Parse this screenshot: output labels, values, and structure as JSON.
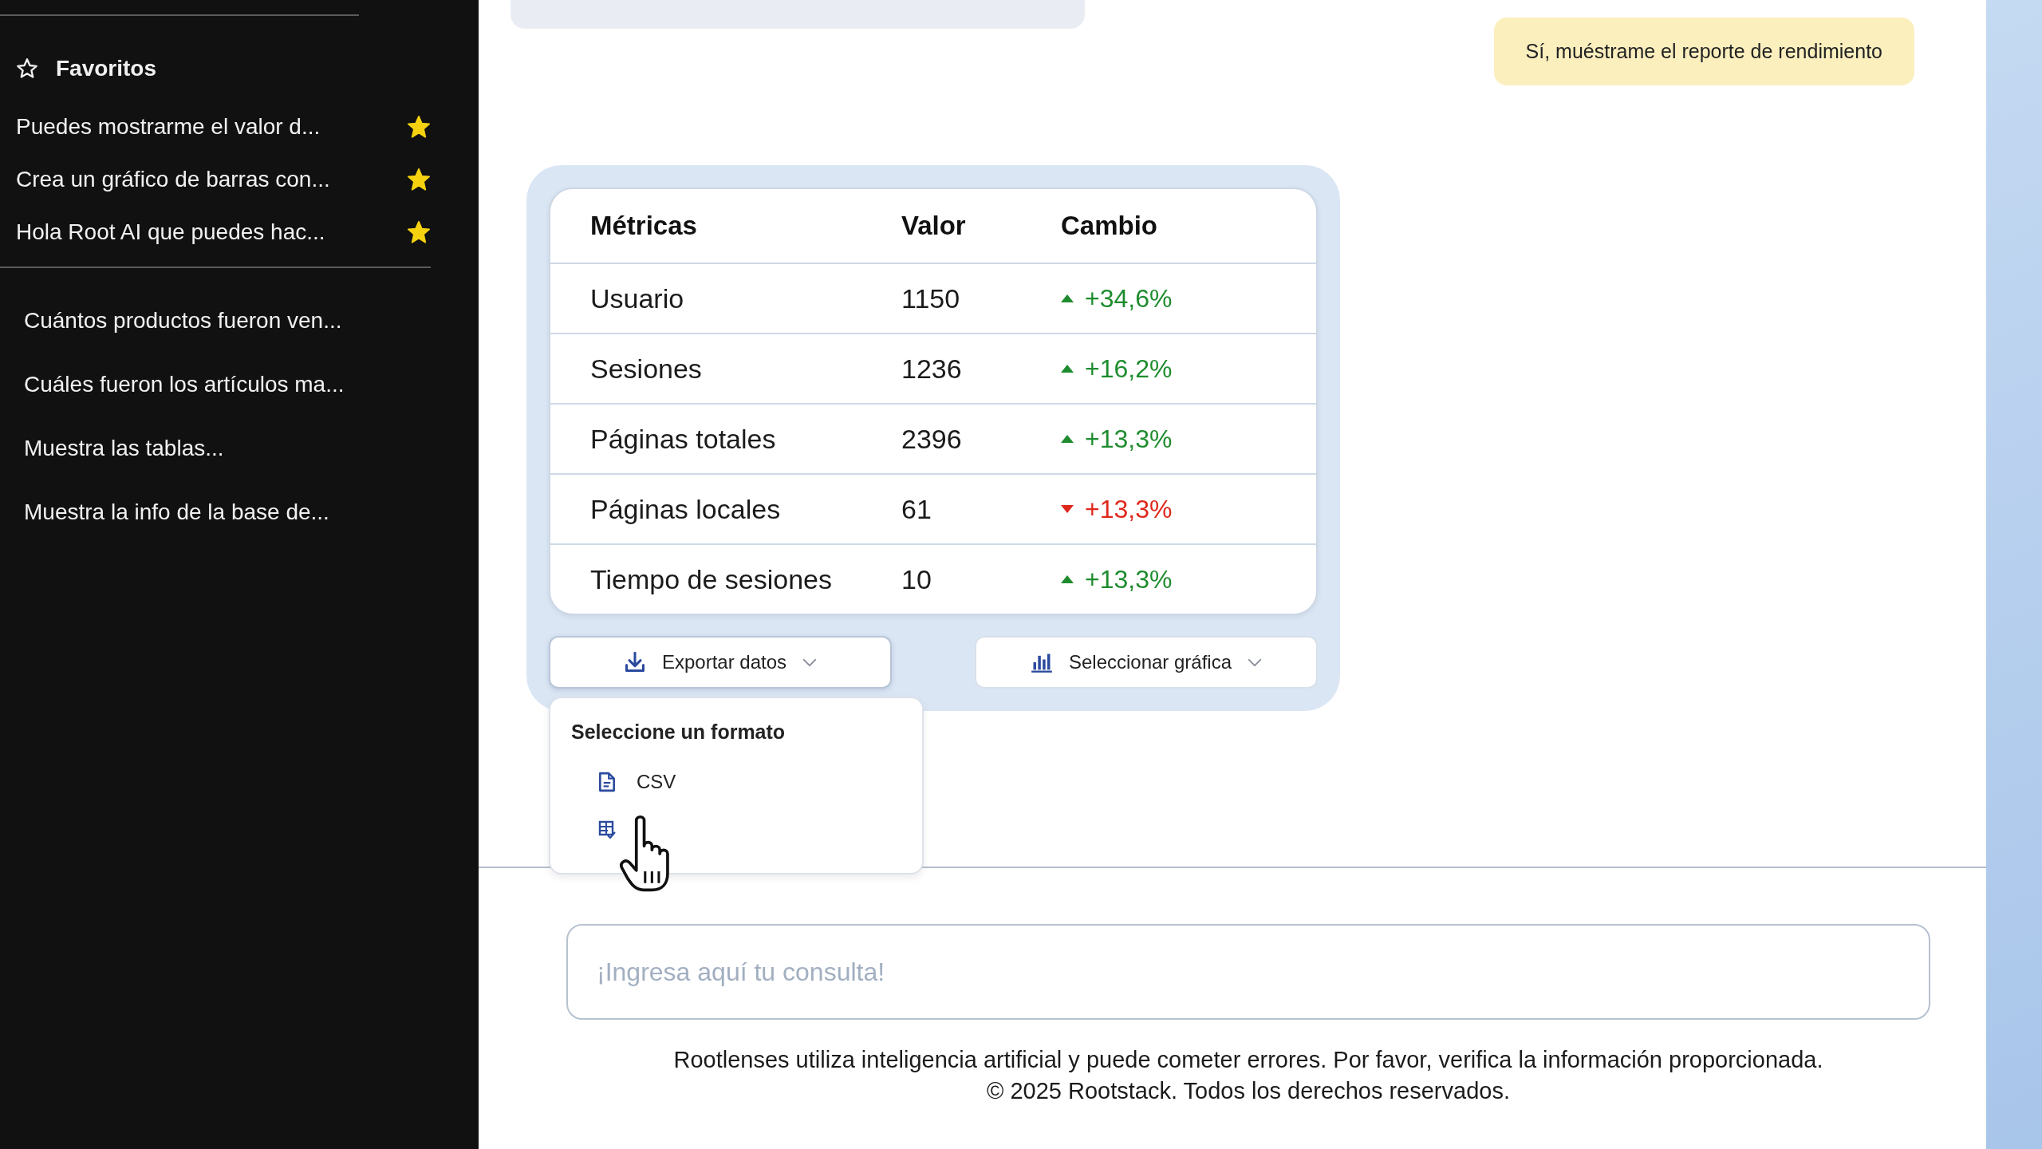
{
  "sidebar": {
    "favorites": {
      "title": "Favoritos",
      "items": [
        {
          "label": "Puedes mostrarme el valor d...",
          "starred": true
        },
        {
          "label": "Crea un gráfico de barras con...",
          "starred": true
        },
        {
          "label": "Hola Root AI que puedes hac...",
          "starred": true
        }
      ]
    },
    "history": [
      {
        "label": "Cuántos productos fueron ven..."
      },
      {
        "label": "Cuáles fueron los artículos ma..."
      },
      {
        "label": "Muestra las tablas..."
      },
      {
        "label": "Muestra la info de la base de..."
      }
    ]
  },
  "chat": {
    "user_message": "Sí, muéstrame el reporte de rendimiento",
    "metrics_table": {
      "columns": [
        "Métricas",
        "Valor",
        "Cambio"
      ],
      "rows": [
        {
          "metric": "Usuario",
          "value": "1150",
          "change": "+34,6%",
          "kind": "up"
        },
        {
          "metric": "Sesiones",
          "value": "1236",
          "change": "+16,2%",
          "kind": "up"
        },
        {
          "metric": "Páginas totales",
          "value": "2396",
          "change": "+13,3%",
          "kind": "up"
        },
        {
          "metric": "Páginas locales",
          "value": "61",
          "change": "+13,3%",
          "kind": "down"
        },
        {
          "metric": "Tiempo de sesiones",
          "value": "10",
          "change": "+13,3%",
          "kind": "up"
        }
      ]
    },
    "export_button": {
      "label": "Exportar datos",
      "expanded": true,
      "menu": {
        "title": "Seleccione un formato",
        "items": [
          {
            "kind": "file",
            "label": "CSV"
          },
          {
            "kind": "table"
          }
        ]
      }
    },
    "chart_button": {
      "label": "Seleccionar gráfica"
    }
  },
  "composer": {
    "placeholder": "¡Ingresa aquí tu consulta!"
  },
  "footer": {
    "disclaimer": "Rootlenses utiliza inteligencia artificial y puede cometer errores. Por favor, verifica la información proporcionada.",
    "copyright": "© 2025 Rootstack. Todos los derechos reservados."
  }
}
